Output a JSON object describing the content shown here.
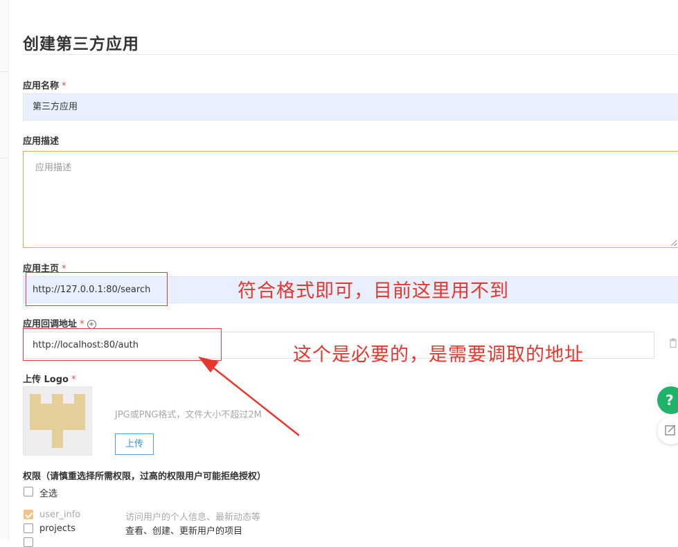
{
  "page": {
    "title": "创建第三方应用"
  },
  "form": {
    "app_name": {
      "label": "应用名称",
      "required": "*",
      "value": "第三方应用"
    },
    "app_desc": {
      "label": "应用描述",
      "placeholder": "应用描述"
    },
    "homepage": {
      "label": "应用主页",
      "required": "*",
      "value": "http://127.0.0.1:80/search"
    },
    "callback": {
      "label": "应用回调地址",
      "required": "*",
      "help_icon": "+",
      "value": "http://localhost:80/auth"
    },
    "logo": {
      "label": "上传 Logo",
      "required": "*",
      "hint": "JPG或PNG格式，文件大小不超过2M",
      "upload_label": "上传"
    },
    "permissions": {
      "label": "权限（请慎重选择所需权限，过高的权限用户可能拒绝授权）",
      "select_all": "全选",
      "items": [
        {
          "name": "user_info",
          "desc": "访问用户的个人信息、最新动态等",
          "checked": true,
          "disabled": true
        },
        {
          "name": "projects",
          "desc": "查看、创建、更新用户的项目",
          "checked": false,
          "disabled": false
        }
      ]
    }
  },
  "annotations": {
    "homepage_note": "符合格式即可，目前这里用不到",
    "callback_note": "这个是必要的，是需要调取的地址",
    "color": "#e8362e"
  },
  "floating": {
    "help_label": "?"
  },
  "colors": {
    "input_bg": "#e8f0fe",
    "focus_border": "#f0a55a",
    "upload_border": "#4aa0e8",
    "help_button": "#1fb36a"
  }
}
